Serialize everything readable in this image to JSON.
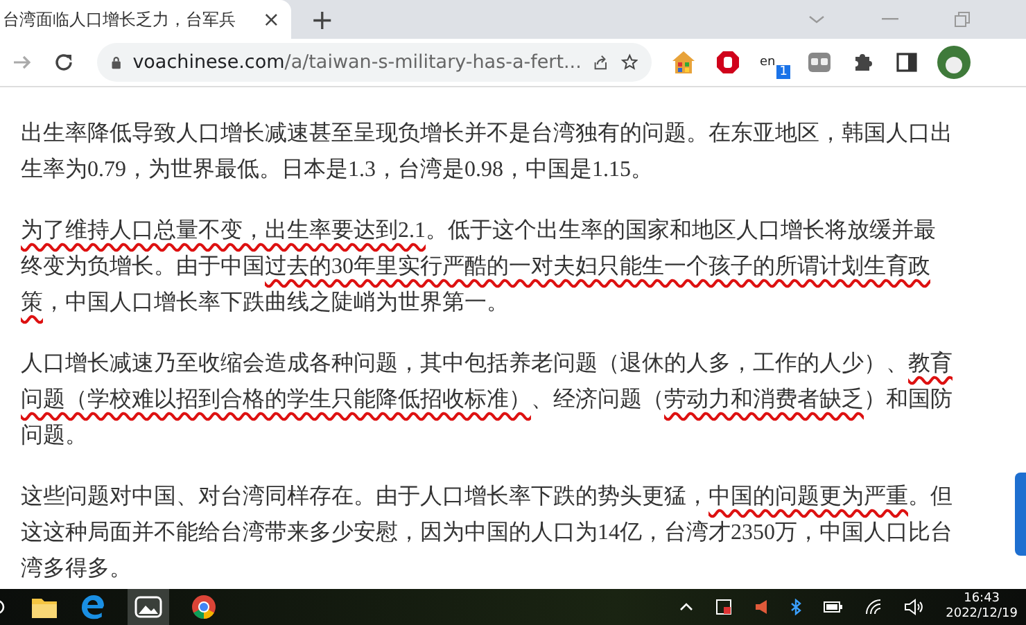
{
  "tab": {
    "title": "台湾面临人口增长乏力，台军兵",
    "close": "×",
    "new_tab": "+"
  },
  "toolbar": {
    "url_domain": "voachinese.com",
    "url_path": "/a/taiwan-s-military-has-a-fert...",
    "extension_label": "en",
    "extension_badge": "1"
  },
  "article": {
    "paragraphs": [
      {
        "lines": [
          [
            {
              "text": "出生率降低导致人口增长减速甚至呈现负增长并不是台湾独有的问题。在东亚地区，韩国人口出",
              "underlined": false
            }
          ],
          [
            {
              "text": "生率为0.79，为世界最低。日本是1.3，台湾是0.98，中国是1.15。",
              "underlined": false
            }
          ]
        ]
      },
      {
        "lines": [
          [
            {
              "text": "为了维持人口总量不变，出生率要达到2.1",
              "underlined": true
            },
            {
              "text": "。低于这个出生率的国家和地区人口增长将放缓并最",
              "underlined": false
            }
          ],
          [
            {
              "text": "终变为负增长。由于中国",
              "underlined": false
            },
            {
              "text": "过去的30年里实行严酷的一对夫妇只能生一个孩子的所谓计划生育政",
              "underlined": true
            }
          ],
          [
            {
              "text": "策",
              "underlined": true
            },
            {
              "text": "，中国人口增长率下跌曲线之陡峭为世界第一。",
              "underlined": false
            }
          ]
        ]
      },
      {
        "lines": [
          [
            {
              "text": "人口增长减速乃至收缩会造成各种问题，其中包括养老问题（退休的人多，工作的人少）、",
              "underlined": false
            },
            {
              "text": "教育",
              "underlined": true
            }
          ],
          [
            {
              "text": "问题（学校难以招到合格的学生只能降低招收标准）",
              "underlined": true
            },
            {
              "text": "、经济问题（",
              "underlined": false
            },
            {
              "text": "劳动力和消费者缺乏",
              "underlined": true
            },
            {
              "text": "）和国防",
              "underlined": false
            }
          ],
          [
            {
              "text": "问题。",
              "underlined": false
            }
          ]
        ]
      },
      {
        "lines": [
          [
            {
              "text": "这些问题对中国、对台湾同样存在。由于人口增长率下跌的势头更猛，",
              "underlined": false
            },
            {
              "text": "中国的问题更为严重",
              "underlined": true
            },
            {
              "text": "。但",
              "underlined": false
            }
          ],
          [
            {
              "text": "这这种局面并不能给台湾带来多少安慰，因为中国的人口为14亿，台湾才2350万，中国人口比台",
              "underlined": false
            }
          ],
          [
            {
              "text": "湾多得多。",
              "underlined": false
            }
          ]
        ]
      }
    ]
  },
  "taskbar": {
    "time": "16:43",
    "date": "2022/12/19"
  }
}
